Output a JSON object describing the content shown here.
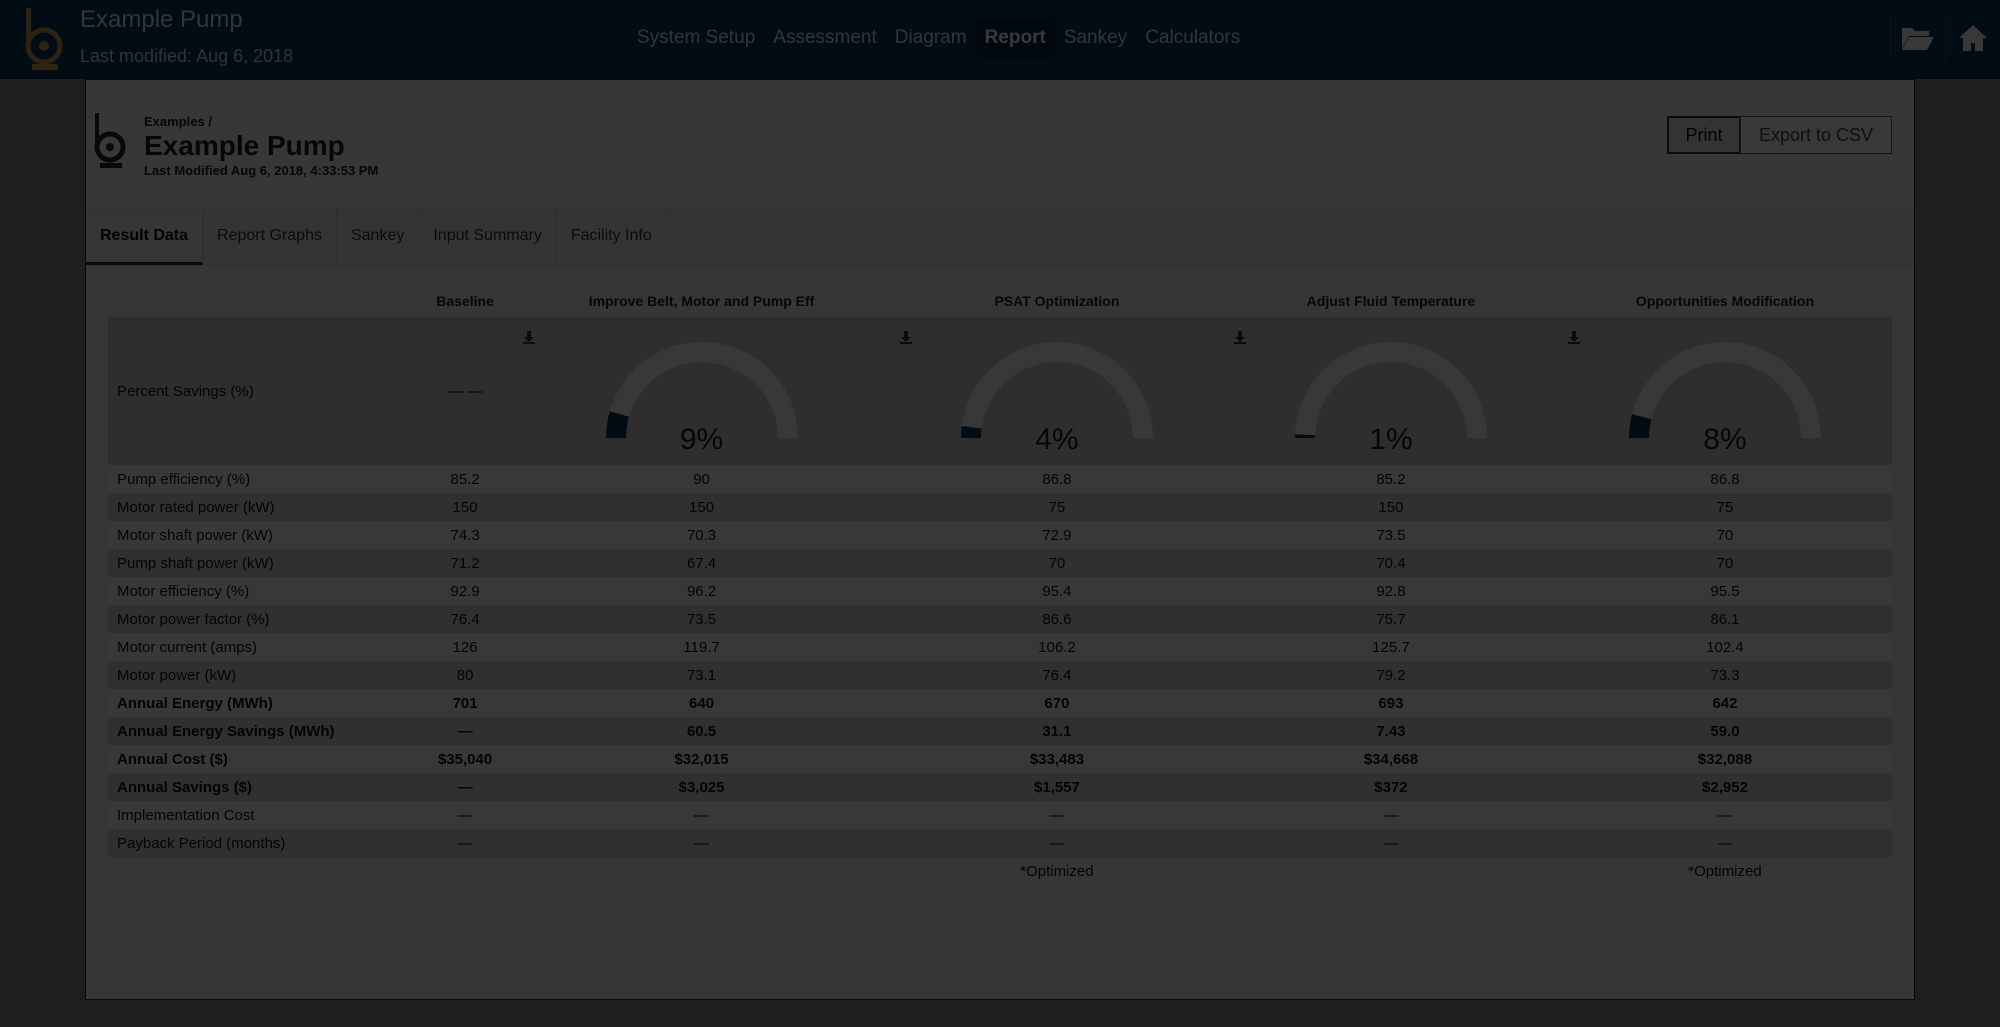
{
  "app": {
    "title": "Example Pump",
    "last_modified": "Last modified: Aug 6, 2018",
    "nav": [
      {
        "label": "System Setup"
      },
      {
        "label": "Assessment"
      },
      {
        "label": "Diagram"
      },
      {
        "label": "Report"
      },
      {
        "label": "Sankey"
      },
      {
        "label": "Calculators"
      }
    ],
    "active_nav": "Report",
    "icons": [
      "folder-open-icon",
      "home-icon"
    ]
  },
  "report": {
    "breadcrumb": "Examples /",
    "title": "Example Pump",
    "modified": "Last Modified Aug 6, 2018, 4:33:53 PM",
    "print_label": "Print",
    "export_label": "Export to CSV",
    "tabs": [
      {
        "label": "Result Data"
      },
      {
        "label": "Report Graphs"
      },
      {
        "label": "Sankey"
      },
      {
        "label": "Input Summary"
      },
      {
        "label": "Facility Info"
      }
    ],
    "active_tab": "Result Data"
  },
  "table": {
    "columns": [
      "Baseline",
      "Improve Belt, Motor and Pump Eff",
      "PSAT Optimization",
      "Adjust Fluid Temperature",
      "Opportunities Modification"
    ],
    "gauge_row_label": "Percent Savings (%)",
    "baseline_gauge_text": "— —",
    "gauges": [
      {
        "value": 9,
        "label": "9%"
      },
      {
        "value": 4,
        "label": "4%"
      },
      {
        "value": 1,
        "label": "1%"
      },
      {
        "value": 8,
        "label": "8%"
      }
    ],
    "rows": [
      {
        "label": "Pump efficiency (%)",
        "values": [
          "85.2",
          "90",
          "86.8",
          "85.2",
          "86.8"
        ],
        "bold": false
      },
      {
        "label": "Motor rated power (kW)",
        "values": [
          "150",
          "150",
          "75",
          "150",
          "75"
        ],
        "bold": false
      },
      {
        "label": "Motor shaft power (kW)",
        "values": [
          "74.3",
          "70.3",
          "72.9",
          "73.5",
          "70"
        ],
        "bold": false
      },
      {
        "label": "Pump shaft power (kW)",
        "values": [
          "71.2",
          "67.4",
          "70",
          "70.4",
          "70"
        ],
        "bold": false
      },
      {
        "label": "Motor efficiency (%)",
        "values": [
          "92.9",
          "96.2",
          "95.4",
          "92.8",
          "95.5"
        ],
        "bold": false
      },
      {
        "label": "Motor power factor (%)",
        "values": [
          "76.4",
          "73.5",
          "86.6",
          "75.7",
          "86.1"
        ],
        "bold": false
      },
      {
        "label": "Motor current (amps)",
        "values": [
          "126",
          "119.7",
          "106.2",
          "125.7",
          "102.4"
        ],
        "bold": false
      },
      {
        "label": "Motor power (kW)",
        "values": [
          "80",
          "73.1",
          "76.4",
          "79.2",
          "73.3"
        ],
        "bold": false
      },
      {
        "label": "Annual Energy (MWh)",
        "values": [
          "701",
          "640",
          "670",
          "693",
          "642"
        ],
        "bold": true
      },
      {
        "label": "Annual Energy Savings (MWh)",
        "values": [
          "—",
          "60.5",
          "31.1",
          "7.43",
          "59.0"
        ],
        "bold": true
      },
      {
        "label": "Annual Cost ($)",
        "values": [
          "$35,040",
          "$32,015",
          "$33,483",
          "$34,668",
          "$32,088"
        ],
        "bold": true
      },
      {
        "label": "Annual Savings ($)",
        "values": [
          "—",
          "$3,025",
          "$1,557",
          "$372",
          "$2,952"
        ],
        "bold": true
      },
      {
        "label": "Implementation Cost",
        "values": [
          "—",
          "—",
          "—",
          "—",
          "—"
        ],
        "bold": false
      },
      {
        "label": "Payback Period (months)",
        "values": [
          "—",
          "—",
          "—",
          "—",
          "—"
        ],
        "bold": false
      }
    ],
    "notes": [
      "",
      "",
      "*Optimized",
      "",
      "*Optimized"
    ]
  },
  "colors": {
    "navbar": "#0b3a5c",
    "gauge_fill": "#0b3a5c",
    "gauge_track": "#ffffff"
  }
}
